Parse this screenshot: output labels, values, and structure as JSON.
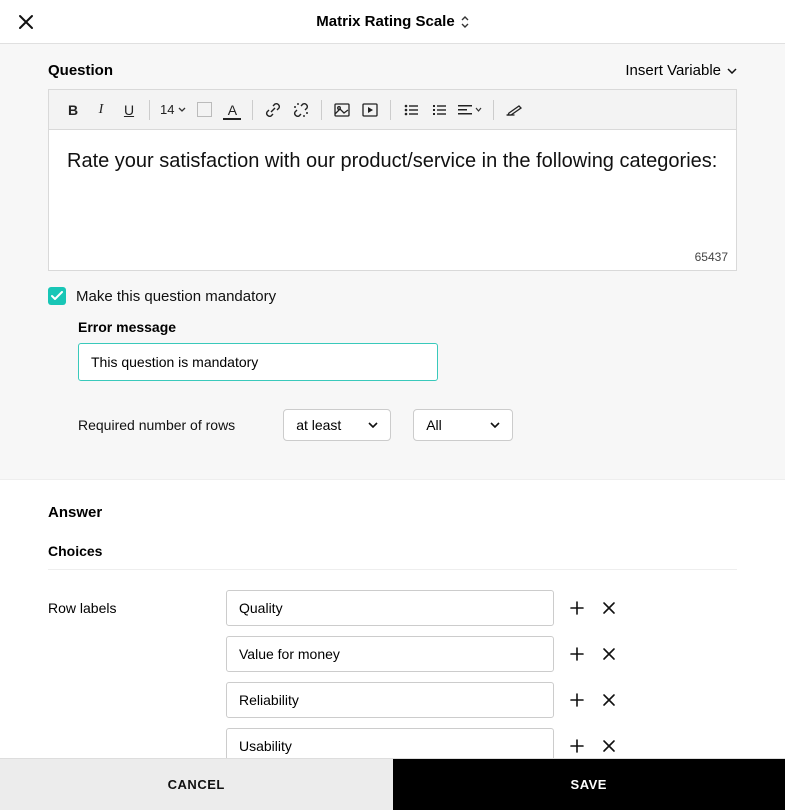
{
  "header": {
    "title": "Matrix Rating Scale"
  },
  "question": {
    "label": "Question",
    "insert_variable_label": "Insert Variable",
    "font_size": "14",
    "text": "Rate your satisfaction with our product/service in the following categories:",
    "char_counter": "65437"
  },
  "mandatory": {
    "checkbox_checked": true,
    "label": "Make this question mandatory",
    "error_title": "Error message",
    "error_value": "This question is mandatory",
    "rows_label": "Required number of rows",
    "rows_condition": "at least",
    "rows_count": "All"
  },
  "answer": {
    "title": "Answer",
    "choices_title": "Choices",
    "row_labels_title": "Row labels",
    "rows": [
      "Quality",
      "Value for money",
      "Reliability",
      "Usability"
    ]
  },
  "footer": {
    "cancel": "CANCEL",
    "save": "SAVE"
  }
}
